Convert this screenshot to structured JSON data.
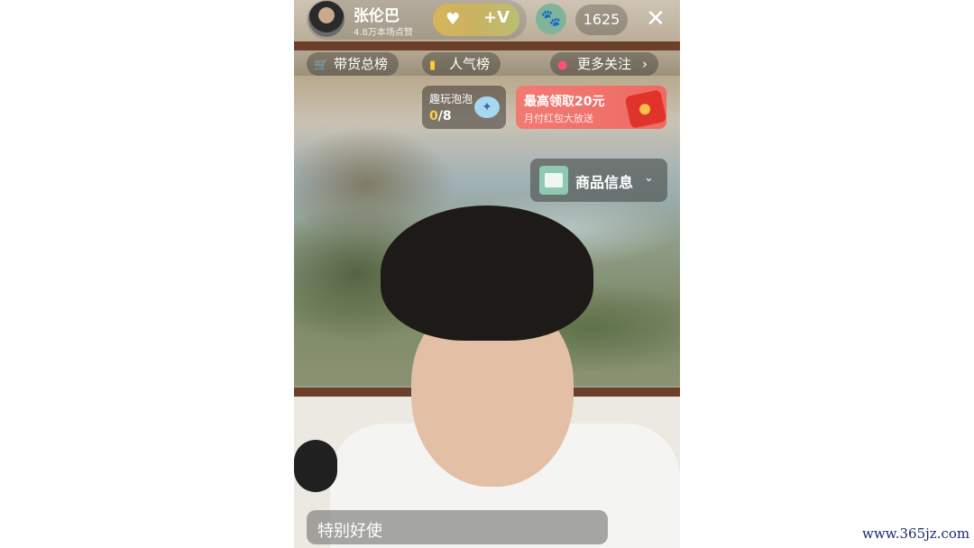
{
  "anchor": {
    "name": "张伦巴",
    "likes": "4.8万本场点赞",
    "fan_heart_icon": "heart-icon",
    "fan_badge": "+V"
  },
  "top": {
    "paw_icon": "paw-icon",
    "viewer_count": "1625",
    "close_icon": "close-icon"
  },
  "ranks": {
    "goods_rank": "带货总榜",
    "popularity_rank": "人气榜",
    "more_follow": "更多关注"
  },
  "bubble_game": {
    "title": "趣玩泡泡",
    "progress_current": "0",
    "progress_total": "/8"
  },
  "red_packet": {
    "title": "最高领取20元",
    "subtitle": "月付红包大放送"
  },
  "product": {
    "label": "商品信息"
  },
  "caption": {
    "text": "特别好使"
  },
  "watermark": {
    "text": "www.365jz.com"
  }
}
